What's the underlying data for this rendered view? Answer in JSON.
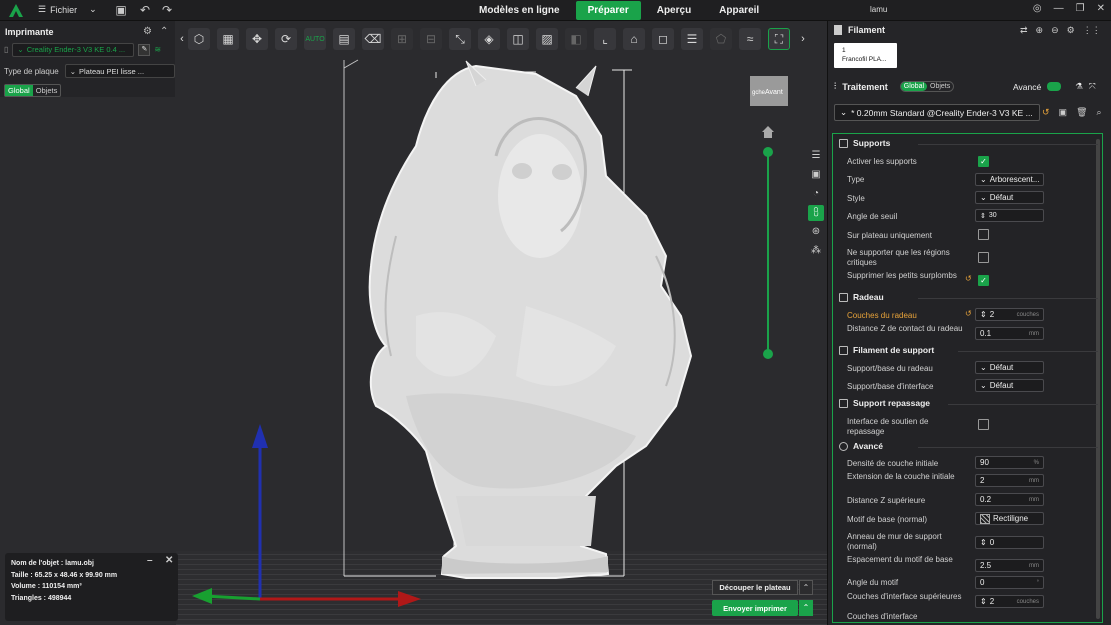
{
  "topbar": {
    "file_label": "Fichier",
    "tabs": [
      {
        "label": "Modèles en ligne",
        "active": false
      },
      {
        "label": "Préparer",
        "active": true
      },
      {
        "label": "Aperçu",
        "active": false
      },
      {
        "label": "Appareil",
        "active": false
      }
    ],
    "project_title": "lamu"
  },
  "left_panel": {
    "title": "Imprimante",
    "printer": "Creality Ender-3 V3 KE 0.4 ...",
    "plate_label": "Type de plaque",
    "plate_value": "Plateau PEI lisse ...",
    "mode_global": "Global",
    "mode_objects": "Objets"
  },
  "viewport": {
    "view_cube_face_a": "gche",
    "view_cube_face_b": "Avant"
  },
  "object_info": {
    "name": "Nom de l'objet : lamu.obj",
    "size": "Taille : 65.25 x 48.46 x 99.90 mm",
    "volume": "Volume : 110154 mm³",
    "triangles": "Triangles : 498944"
  },
  "actions": {
    "slice": "Découper le plateau",
    "send": "Envoyer imprimer"
  },
  "right_panel": {
    "filament_title": "Filament",
    "filament_slot": "1",
    "filament_name": "Francofil PLA...",
    "process_title": "Traitement",
    "process_global": "Global",
    "process_objects": "Objets",
    "advanced_label": "Avancé",
    "profile": "* 0.20mm Standard @Creality Ender-3 V3 KE ..."
  },
  "settings": {
    "supports": "Supports",
    "enable_supports": "Activer les supports",
    "type": "Type",
    "type_value": "Arborescent...",
    "style": "Style",
    "style_value": "Défaut",
    "threshold_angle": "Angle de seuil",
    "threshold_value": "30",
    "on_plate_only": "Sur plateau uniquement",
    "critical_only": "Ne supporter que les régions critiques",
    "remove_small": "Supprimer les petits surplombs",
    "raft": "Radeau",
    "raft_layers": "Couches du radeau",
    "raft_layers_value": "2",
    "raft_layers_unit": "couches",
    "raft_z": "Distance Z de contact du radeau",
    "raft_z_value": "0.1",
    "raft_z_unit": "mm",
    "support_filament": "Filament de support",
    "raft_base": "Support/base du radeau",
    "raft_base_value": "Défaut",
    "interface_base": "Support/base d'interface",
    "interface_base_value": "Défaut",
    "ironing": "Support repassage",
    "ironing_interface": "Interface de soutien de repassage",
    "advanced": "Avancé",
    "initial_density": "Densité de couche initiale",
    "initial_density_value": "90",
    "initial_density_unit": "%",
    "initial_expansion": "Extension de la couche initiale",
    "initial_expansion_value": "2",
    "initial_expansion_unit": "mm",
    "top_z": "Distance Z supérieure",
    "top_z_value": "0.2",
    "top_z_unit": "mm",
    "base_pattern": "Motif de base (normal)",
    "base_pattern_value": "Rectiligne",
    "wall_loops": "Anneau de mur de support (normal)",
    "wall_loops_value": "0",
    "pattern_spacing": "Espacement du motif de base",
    "pattern_spacing_value": "2.5",
    "pattern_spacing_unit": "mm",
    "pattern_angle": "Angle du motif",
    "pattern_angle_value": "0",
    "pattern_angle_unit": "°",
    "top_interface_layers": "Couches d'interface supérieures",
    "top_interface_layers_value": "2",
    "top_interface_layers_unit": "couches",
    "bottom_interface_layers": "Couches d'interface"
  },
  "colors": {
    "accent": "#1aa34a",
    "warning": "#e8a33a"
  }
}
